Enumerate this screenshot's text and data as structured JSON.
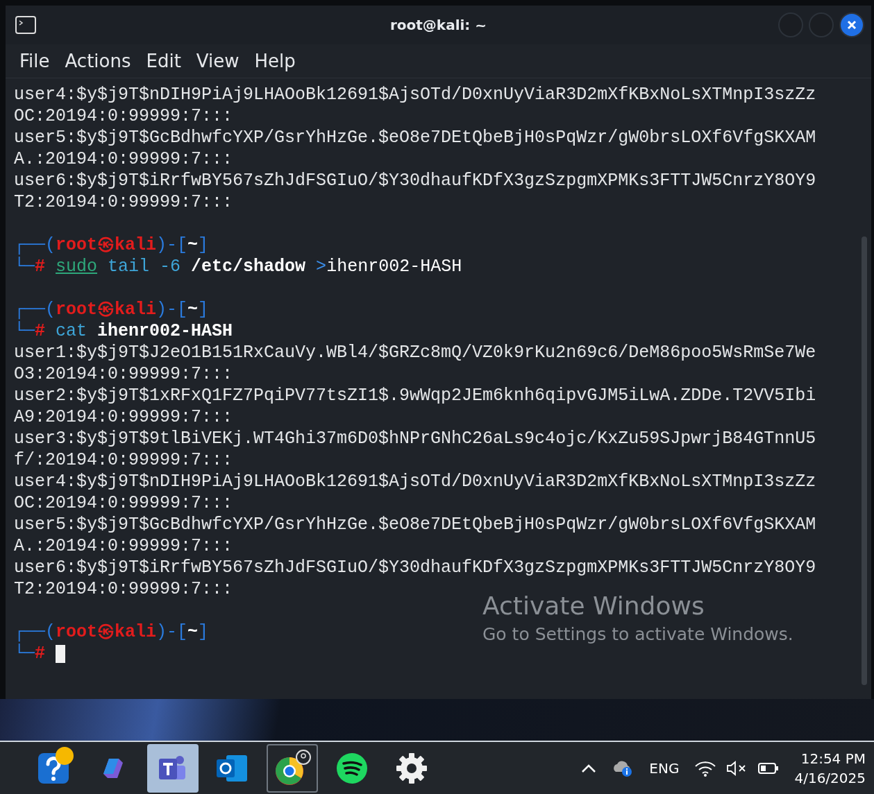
{
  "window": {
    "title": "root@kali: ~",
    "menu": [
      "File",
      "Actions",
      "Edit",
      "View",
      "Help"
    ]
  },
  "terminal": {
    "lines": [
      {
        "kind": "output",
        "text": "user4:$y$j9T$nDIH9PiAj9LHAOoBk12691$AjsOTd/D0xnUyViaR3D2mXfKBxNoLsXTMnpI3szZz"
      },
      {
        "kind": "output",
        "text": "OC:20194:0:99999:7:::"
      },
      {
        "kind": "output",
        "text": "user5:$y$j9T$GcBdhwfcYXP/GsrYhHzGe.$eO8e7DEtQbeBjH0sPqWzr/gW0brsLOXf6VfgSKXAM"
      },
      {
        "kind": "output",
        "text": "A.:20194:0:99999:7:::"
      },
      {
        "kind": "output",
        "text": "user6:$y$j9T$iRrfwBY567sZhJdFSGIuO/$Y30dhaufKDfX3gzSzpgmXPMKs3FTTJW5CnrzY8OY9"
      },
      {
        "kind": "output",
        "text": "T2:20194:0:99999:7:::"
      },
      {
        "kind": "blank"
      },
      {
        "kind": "prompt",
        "top": "┌──(",
        "user": "root",
        "at": "㉿",
        "host": "kali",
        "mid": ")-[",
        "dir": "~",
        "end": "]",
        "bottom": "└─",
        "hash": "#",
        "cursor": false,
        "tokens": [
          {
            "kind": "sudo",
            "text": "sudo"
          },
          {
            "kind": "command",
            "text": "tail"
          },
          {
            "kind": "command",
            "text": "-6"
          },
          {
            "kind": "path",
            "text": "/etc/shadow"
          },
          {
            "kind": "redirect",
            "text": ">"
          },
          {
            "kind": "plain",
            "text": "ihenr002-HASH"
          }
        ]
      },
      {
        "kind": "blank"
      },
      {
        "kind": "prompt",
        "top": "┌──(",
        "user": "root",
        "at": "㉿",
        "host": "kali",
        "mid": ")-[",
        "dir": "~",
        "end": "]",
        "bottom": "└─",
        "hash": "#",
        "cursor": false,
        "tokens": [
          {
            "kind": "command",
            "text": "cat"
          },
          {
            "kind": "path",
            "text": "ihenr002-HASH"
          }
        ]
      },
      {
        "kind": "output",
        "text": "user1:$y$j9T$J2eO1B151RxCauVy.WBl4/$GRZc8mQ/VZ0k9rKu2n69c6/DeM86poo5WsRmSe7We"
      },
      {
        "kind": "output",
        "text": "O3:20194:0:99999:7:::"
      },
      {
        "kind": "output",
        "text": "user2:$y$j9T$1xRFxQ1FZ7PqiPV77tsZI1$.9wWqp2JEm6knh6qipvGJM5iLwA.ZDDe.T2VV5Ibi"
      },
      {
        "kind": "output",
        "text": "A9:20194:0:99999:7:::"
      },
      {
        "kind": "output",
        "text": "user3:$y$j9T$9tlBiVEKj.WT4Ghi37m6D0$hNPrGNhC26aLs9c4ojc/KxZu59SJpwrjB84GTnnU5"
      },
      {
        "kind": "output",
        "text": "f/:20194:0:99999:7:::"
      },
      {
        "kind": "output",
        "text": "user4:$y$j9T$nDIH9PiAj9LHAOoBk12691$AjsOTd/D0xnUyViaR3D2mXfKBxNoLsXTMnpI3szZz"
      },
      {
        "kind": "output",
        "text": "OC:20194:0:99999:7:::"
      },
      {
        "kind": "output",
        "text": "user5:$y$j9T$GcBdhwfcYXP/GsrYhHzGe.$eO8e7DEtQbeBjH0sPqWzr/gW0brsLOXf6VfgSKXAM"
      },
      {
        "kind": "output",
        "text": "A.:20194:0:99999:7:::"
      },
      {
        "kind": "output",
        "text": "user6:$y$j9T$iRrfwBY567sZhJdFSGIuO/$Y30dhaufKDfX3gzSzpgmXPMKs3FTTJW5CnrzY8OY9"
      },
      {
        "kind": "output",
        "text": "T2:20194:0:99999:7:::"
      },
      {
        "kind": "blank"
      },
      {
        "kind": "prompt",
        "top": "┌──(",
        "user": "root",
        "at": "㉿",
        "host": "kali",
        "mid": ")-[",
        "dir": "~",
        "end": "]",
        "bottom": "└─",
        "hash": "#",
        "cursor": true
      }
    ]
  },
  "activation": {
    "title": "Activate Windows",
    "subtitle": "Go to Settings to activate Windows."
  },
  "taskbar": {
    "apps": [
      {
        "selected": false,
        "focused": false,
        "badge": true
      },
      {
        "selected": false,
        "focused": false,
        "badge": false
      },
      {
        "selected": true,
        "focused": false,
        "badge": false
      },
      {
        "selected": false,
        "focused": false,
        "badge": false
      },
      {
        "selected": false,
        "focused": true,
        "badge": false
      },
      {
        "selected": false,
        "focused": false,
        "badge": false
      },
      {
        "selected": false,
        "focused": false,
        "badge": false
      }
    ],
    "language": "ENG",
    "time": "12:54 PM",
    "date": "4/16/2025"
  }
}
